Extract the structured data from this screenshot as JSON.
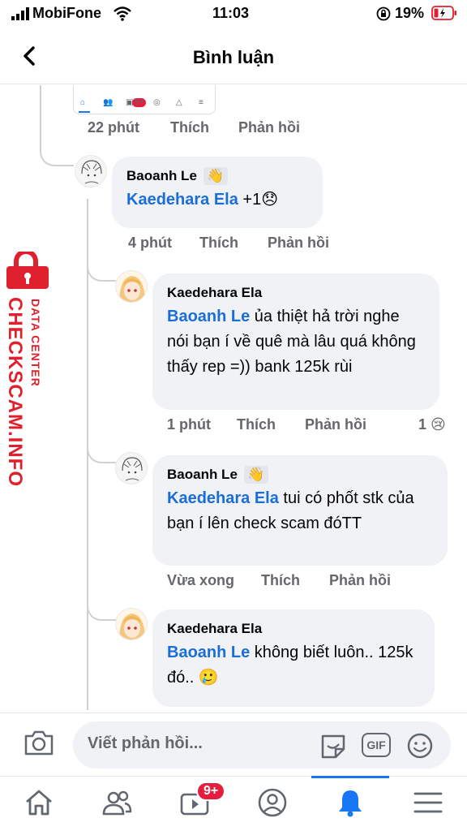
{
  "status_bar": {
    "carrier": "MobiFone",
    "time": "11:03",
    "battery": "19%"
  },
  "header": {
    "title": "Bình luận"
  },
  "mini_nav": {
    "badge": "9+"
  },
  "comments": [
    {
      "meta": {
        "time": "22 phút",
        "like": "Thích",
        "reply": "Phản hồi"
      }
    },
    {
      "author": "Baoanh Le",
      "mention": "Kaedehara Ela",
      "text": " +1😞",
      "meta": {
        "time": "4 phút",
        "like": "Thích",
        "reply": "Phản hồi"
      }
    },
    {
      "author": "Kaedehara Ela",
      "mention": "Baoanh Le",
      "text": " ủa thiệt hả trời nghe nói bạn í về quê mà lâu quá không thấy rep =)) bank 125k rùi",
      "meta": {
        "time": "1 phút",
        "like": "Thích",
        "reply": "Phản hồi"
      },
      "reaction": "1 😢"
    },
    {
      "author": "Baoanh Le",
      "mention": "Kaedehara Ela",
      "text": " tui có phốt stk của bạn í lên check scam đóTT",
      "meta": {
        "time": "Vừa xong",
        "like": "Thích",
        "reply": "Phản hồi"
      }
    },
    {
      "author": "Kaedehara Ela",
      "mention": "Baoanh Le",
      "text": " không biết luôn.. 125k đó.. 🥲"
    }
  ],
  "composer": {
    "placeholder": "Viết phản hồi...",
    "gif": "GIF"
  },
  "tabbar": {
    "video_badge": "9+"
  },
  "watermark": {
    "line1": "DATA CENTER",
    "line2": "CHECKSCAM.INFO"
  },
  "colors": {
    "accent": "#1877f2",
    "mention": "#1a6ed8",
    "badge": "#e41e3f",
    "watermark": "#e0202c"
  }
}
